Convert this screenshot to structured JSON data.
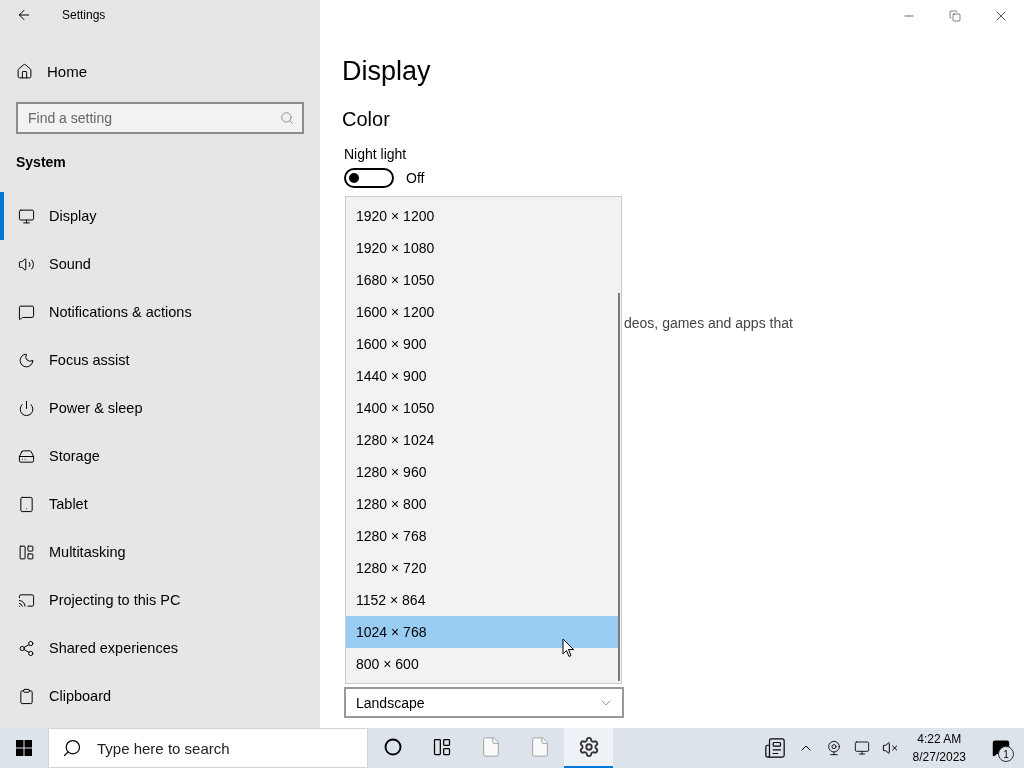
{
  "window": {
    "title": "Settings"
  },
  "sidebar": {
    "home": "Home",
    "search": {
      "placeholder": "Find a setting"
    },
    "section": "System",
    "items": [
      {
        "label": "Display",
        "selected": true
      },
      {
        "label": "Sound",
        "selected": false
      },
      {
        "label": "Notifications & actions",
        "selected": false
      },
      {
        "label": "Focus assist",
        "selected": false
      },
      {
        "label": "Power & sleep",
        "selected": false
      },
      {
        "label": "Storage",
        "selected": false
      },
      {
        "label": "Tablet",
        "selected": false
      },
      {
        "label": "Multitasking",
        "selected": false
      },
      {
        "label": "Projecting to this PC",
        "selected": false
      },
      {
        "label": "Shared experiences",
        "selected": false
      },
      {
        "label": "Clipboard",
        "selected": false
      }
    ]
  },
  "main": {
    "title": "Display",
    "section": "Color",
    "night_light": {
      "label": "Night light",
      "on": false,
      "state": "Off"
    },
    "partial_text": "deos, games and apps that",
    "resolution_dropdown": {
      "options": [
        {
          "label": "1920 × 1200",
          "selected": false
        },
        {
          "label": "1920 × 1080",
          "selected": false
        },
        {
          "label": "1680 × 1050",
          "selected": false
        },
        {
          "label": "1600 × 1200",
          "selected": false
        },
        {
          "label": "1600 × 900",
          "selected": false
        },
        {
          "label": "1440 × 900",
          "selected": false
        },
        {
          "label": "1400 × 1050",
          "selected": false
        },
        {
          "label": "1280 × 1024",
          "selected": false
        },
        {
          "label": "1280 × 960",
          "selected": false
        },
        {
          "label": "1280 × 800",
          "selected": false
        },
        {
          "label": "1280 × 768",
          "selected": false
        },
        {
          "label": "1280 × 720",
          "selected": false
        },
        {
          "label": "1152 × 864",
          "selected": false
        },
        {
          "label": "1024 × 768",
          "selected": true
        },
        {
          "label": "800 × 600",
          "selected": false
        }
      ]
    },
    "orientation": {
      "value": "Landscape"
    }
  },
  "taskbar": {
    "search": {
      "placeholder": "Type here to search"
    },
    "apps": [
      {
        "kind": "cortana",
        "active": false
      },
      {
        "kind": "taskview",
        "active": false
      },
      {
        "kind": "file",
        "active": false
      },
      {
        "kind": "file",
        "active": false
      },
      {
        "kind": "settings",
        "active": true
      }
    ],
    "clock": {
      "time": "4:22 AM",
      "date": "8/27/2023"
    },
    "notifications": {
      "count": "1"
    }
  }
}
